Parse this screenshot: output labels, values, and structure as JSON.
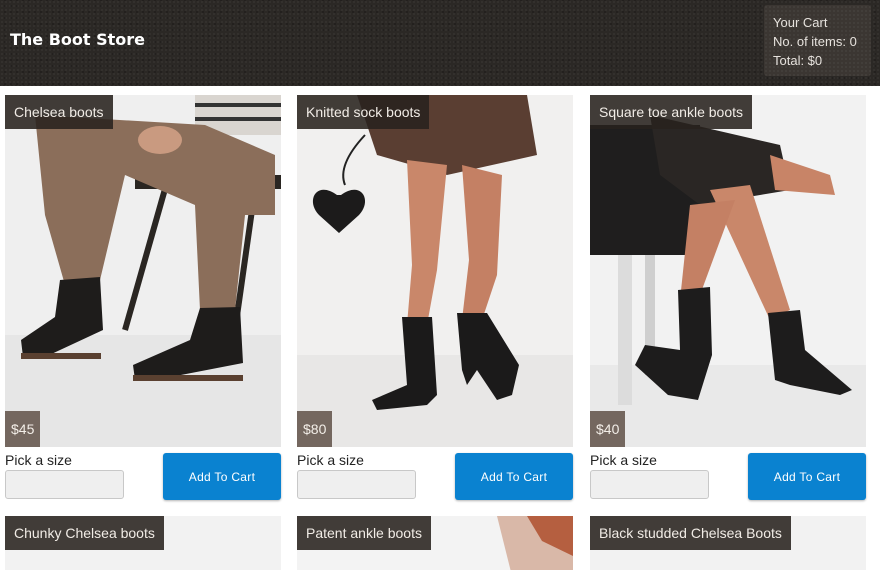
{
  "header": {
    "brand": "The Boot Store",
    "cart": {
      "title": "Your Cart",
      "items_line": "No. of items: 0",
      "total_line": "Total: $0"
    }
  },
  "products": [
    {
      "name": "Chelsea boots",
      "price": "$45",
      "size_label": "Pick a size",
      "size_value": "",
      "button": "Add To Cart"
    },
    {
      "name": "Knitted sock boots",
      "price": "$80",
      "size_label": "Pick a size",
      "size_value": "",
      "button": "Add To Cart"
    },
    {
      "name": "Square toe ankle boots",
      "price": "$40",
      "size_label": "Pick a size",
      "size_value": "",
      "button": "Add To Cart"
    },
    {
      "name": "Chunky Chelsea boots"
    },
    {
      "name": "Patent ankle boots"
    },
    {
      "name": "Black studded Chelsea Boots"
    }
  ],
  "colors": {
    "header_bg": "#2b2825",
    "button_bg": "#0a82d0",
    "tag_bg": "#28221e"
  }
}
